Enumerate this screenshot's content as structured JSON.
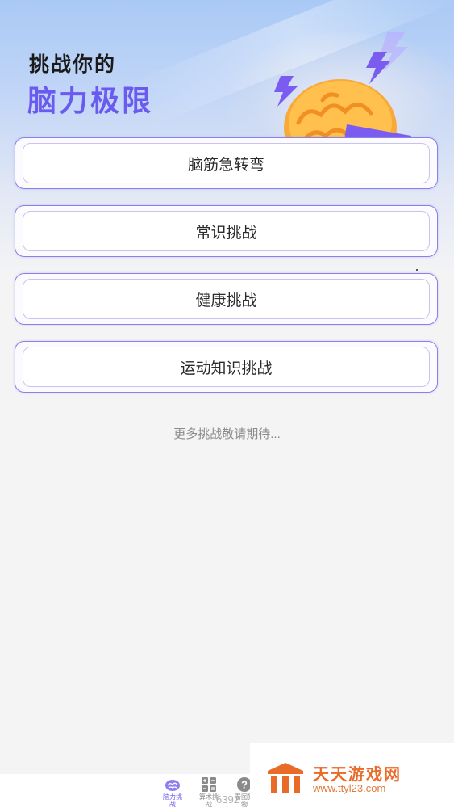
{
  "hero": {
    "title_line1": "挑战你的",
    "title_line2": "脑力极限",
    "accent_color": "#6a5af0"
  },
  "challenges": [
    {
      "label": "脑筋急转弯"
    },
    {
      "label": "常识挑战"
    },
    {
      "label": "健康挑战"
    },
    {
      "label": "运动知识挑战"
    }
  ],
  "footer_note": "更多挑战敬请期待...",
  "tabbar": {
    "tabs": [
      {
        "label": "脑力挑战",
        "icon": "brain-icon",
        "active": true
      },
      {
        "label": "算术挑战",
        "icon": "calculator-icon",
        "active": false
      },
      {
        "label": "看图猜物",
        "icon": "question-icon",
        "active": false
      }
    ]
  },
  "watermark": {
    "name": "天天游戏网",
    "url": "www.ttyl23.com",
    "fragment": "6392"
  }
}
